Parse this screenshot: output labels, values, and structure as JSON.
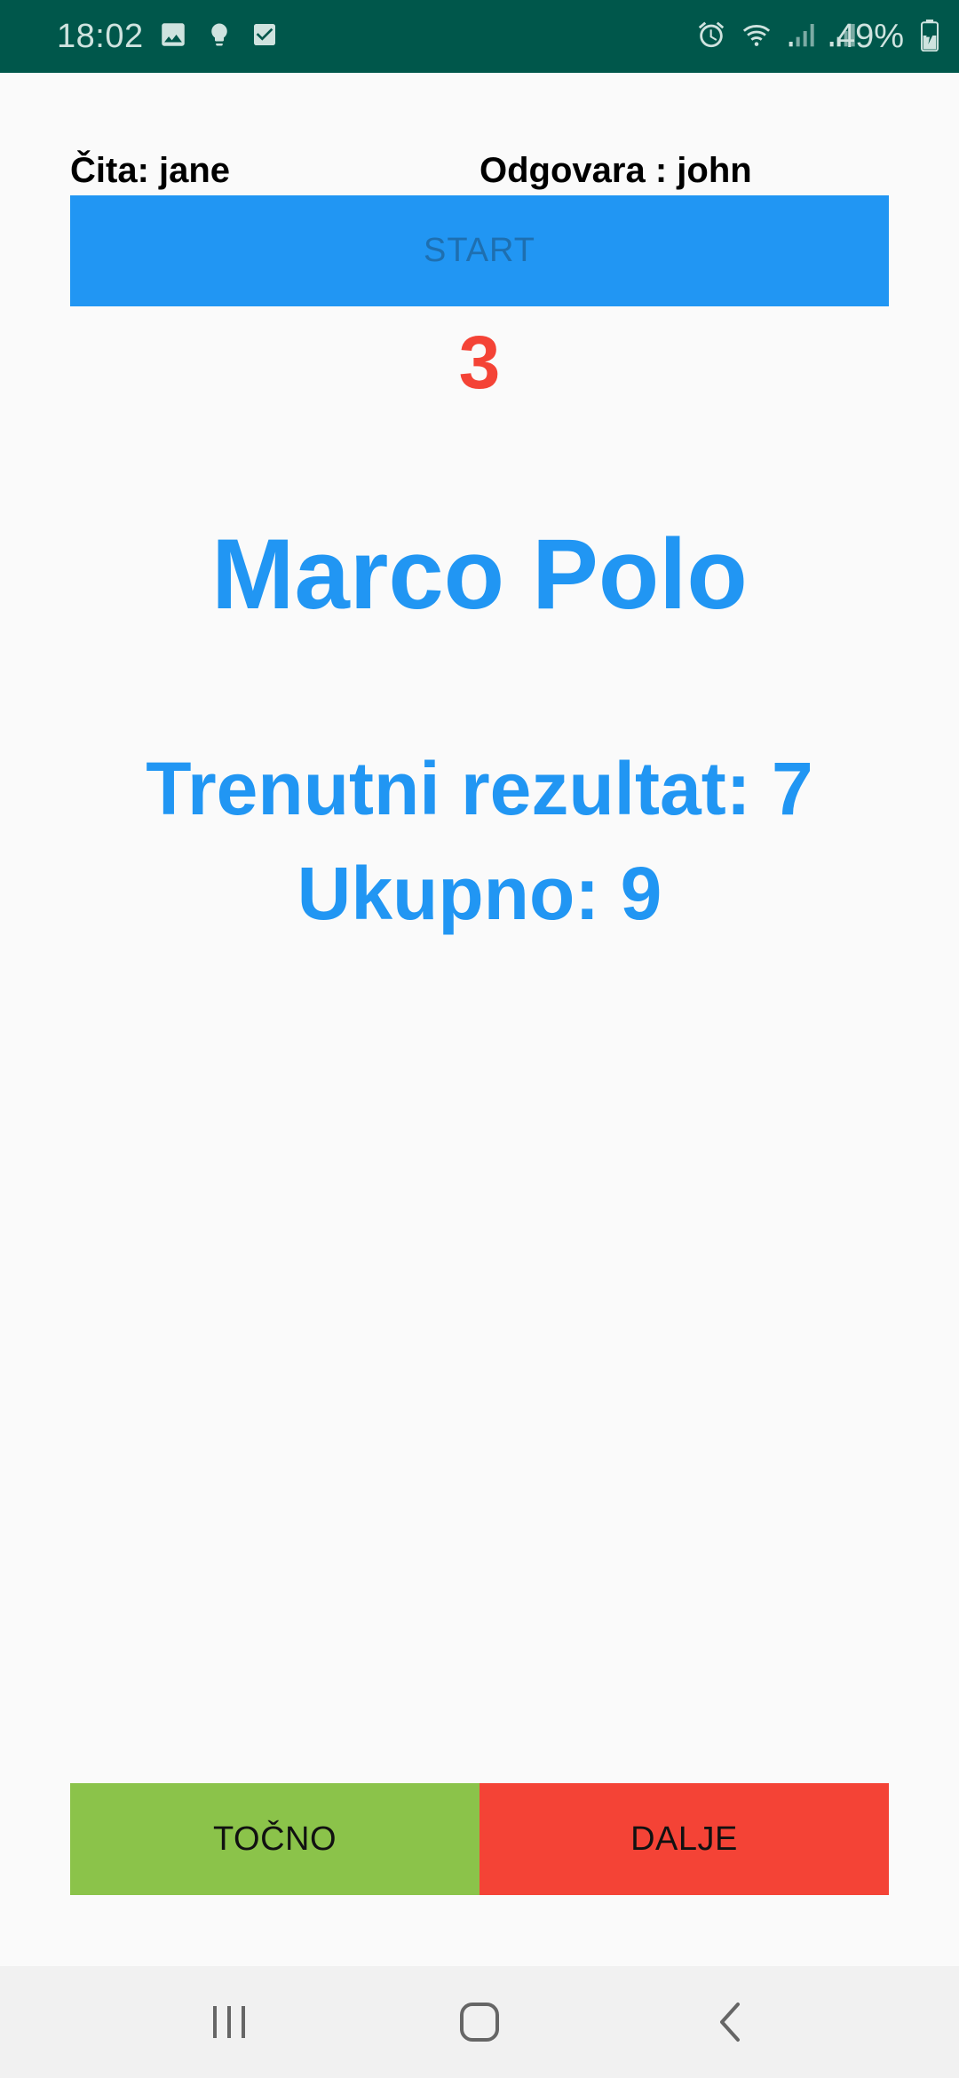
{
  "status_bar": {
    "time": "18:02",
    "battery": "49%",
    "left_icons": [
      "image-icon",
      "bulb-icon",
      "checkbox-icon"
    ],
    "right_icons": [
      "alarm-icon",
      "wifi-icon",
      "signal-icon",
      "signal-icon",
      "battery-charging-icon"
    ]
  },
  "players": {
    "reader": "Čita: jane",
    "answerer": "Odgovara : john"
  },
  "start_button": "START",
  "countdown": "3",
  "word": "Marco Polo",
  "score": {
    "current": "Trenutni rezultat: 7",
    "total": "Ukupno: 9"
  },
  "actions": {
    "correct": "TOČNO",
    "next": "DALJE"
  },
  "colors": {
    "status_bar": "#00574b",
    "primary": "#2196f3",
    "countdown": "#f44336",
    "correct_button": "#8bc34a",
    "next_button": "#f44336"
  },
  "nav": [
    "recents-icon",
    "home-icon",
    "back-icon"
  ]
}
